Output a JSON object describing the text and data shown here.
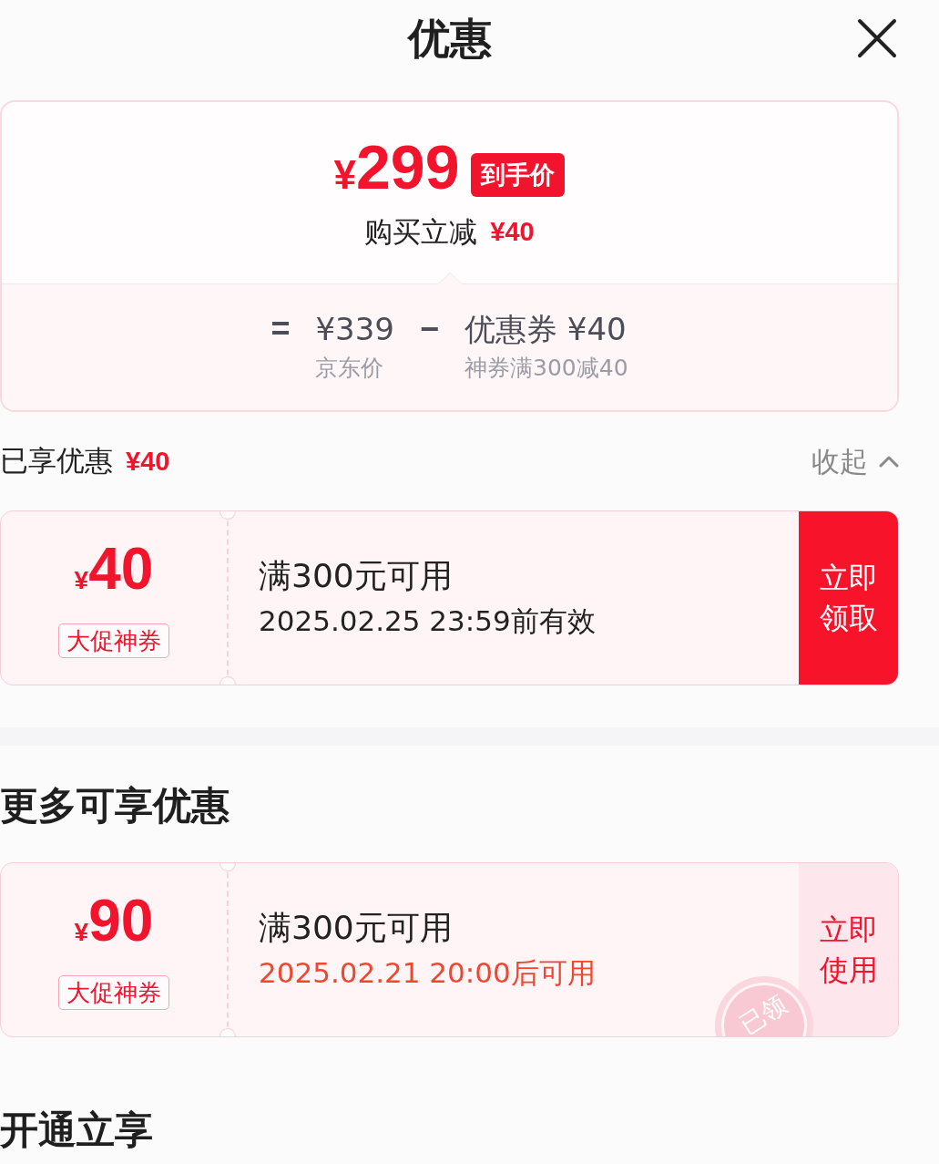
{
  "header": {
    "title": "优惠"
  },
  "summary": {
    "price": {
      "currency": "¥",
      "amount": "299"
    },
    "price_badge": "到手价",
    "discount_label": "购买立减",
    "discount_amount": "¥40",
    "breakdown": [
      {
        "kind": "operator",
        "text": "="
      },
      {
        "kind": "term",
        "amount": "¥339",
        "caption": "京东价"
      },
      {
        "kind": "operator",
        "text": "−"
      },
      {
        "kind": "term",
        "amount": "优惠券 ¥40",
        "caption": "神券满300减40"
      }
    ]
  },
  "applied": {
    "label": "已享优惠",
    "amount": "¥40",
    "toggle": "收起",
    "expanded": true,
    "coupons": [
      {
        "currency": "¥",
        "amount": "40",
        "tag": "大促神券",
        "condition": "满300元可用",
        "validity": "2025.02.25 23:59前有效",
        "action": "立即领取",
        "claimed": false
      }
    ]
  },
  "more_offers": {
    "title": "更多可享优惠",
    "coupons": [
      {
        "currency": "¥",
        "amount": "90",
        "tag": "大促神券",
        "condition": "满300元可用",
        "validity": "2025.02.21 20:00后可用",
        "action": "立即使用",
        "claimed": true,
        "stamp": "已领"
      }
    ]
  },
  "membership": {
    "title": "开通立享"
  }
}
